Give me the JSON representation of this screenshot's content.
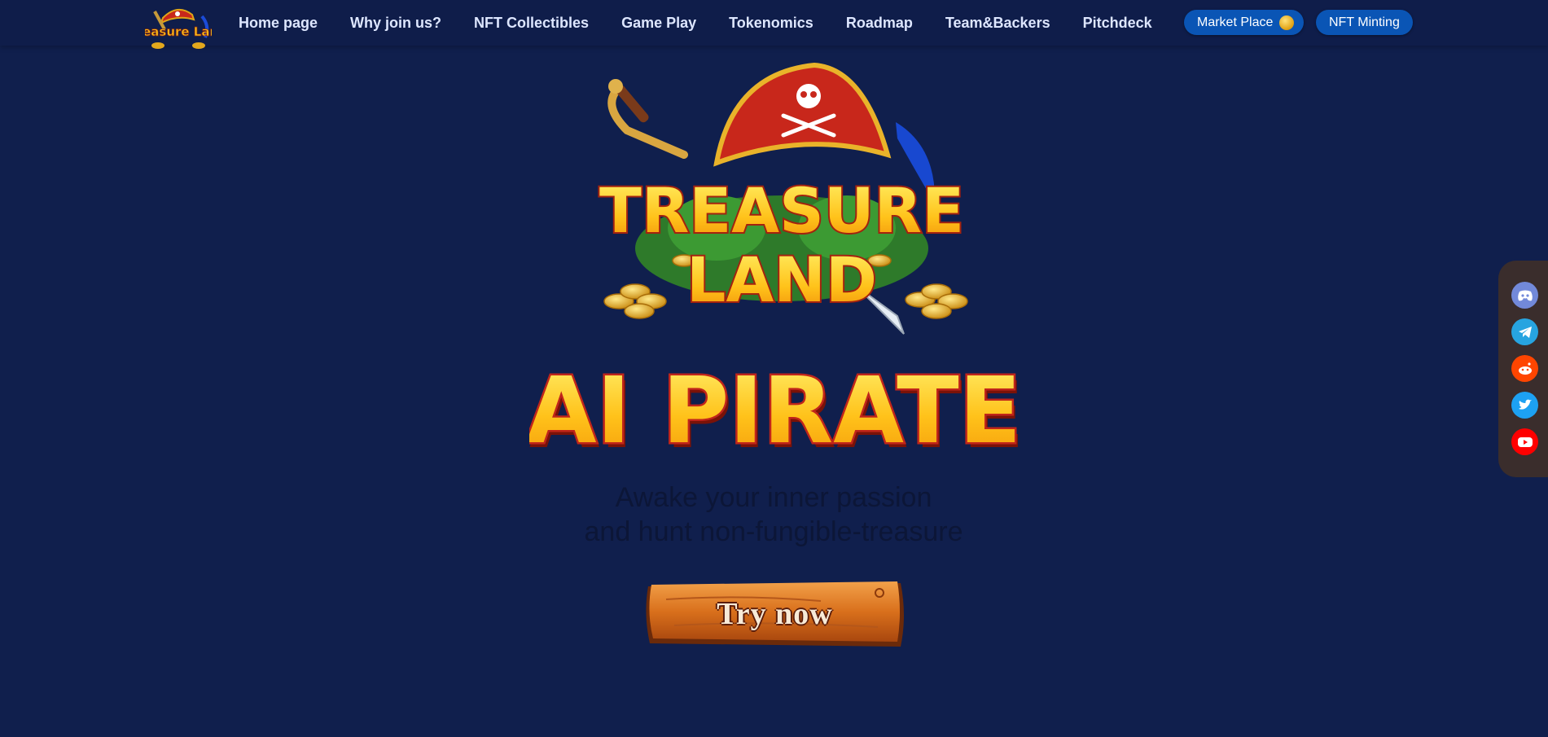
{
  "nav": {
    "logo_alt": "Treasure Land",
    "links": [
      "Home page",
      "Why join us?",
      "NFT Collectibles",
      "Game Play",
      "Tokenomics",
      "Roadmap",
      "Team&Backers",
      "Pitchdeck"
    ],
    "market_place": "Market Place",
    "nft_minting": "NFT Minting"
  },
  "hero": {
    "logo_line1": "TREASURE",
    "logo_line2": "LAND",
    "title": "AI PIRATE",
    "tagline_line1": "Awake your inner passion",
    "tagline_line2": "and hunt non-fungible-treasure",
    "cta": "Try now"
  },
  "social": [
    {
      "name": "discord-icon",
      "color": "#7289da"
    },
    {
      "name": "telegram-icon",
      "color": "#27a4e0"
    },
    {
      "name": "reddit-icon",
      "color": "#ff4500"
    },
    {
      "name": "twitter-icon",
      "color": "#1da1f2"
    },
    {
      "name": "youtube-icon",
      "color": "#ff0000"
    }
  ],
  "colors": {
    "background": "#101f4d",
    "pill": "#0a55b5",
    "title_gold": "#ffc21a",
    "title_red": "#c0251a"
  }
}
